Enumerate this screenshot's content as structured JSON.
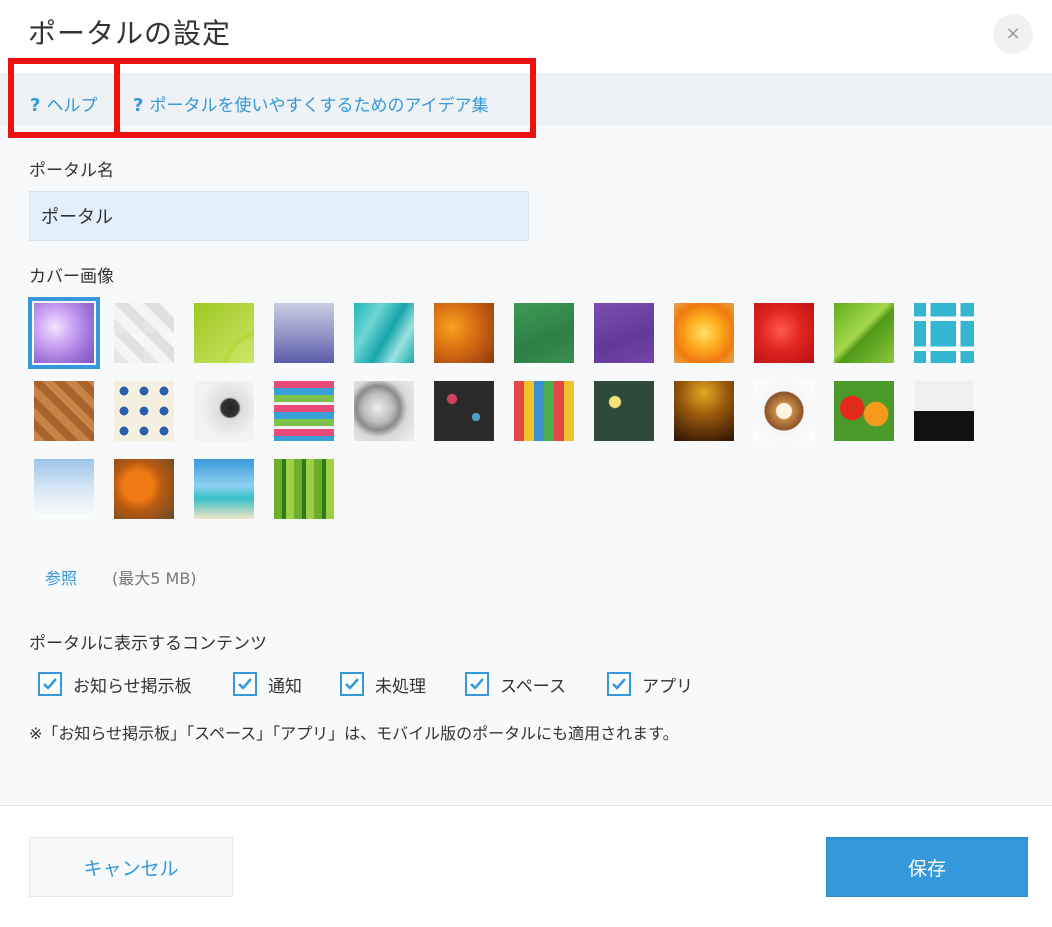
{
  "dialog": {
    "title": "ポータルの設定",
    "close_label": "×"
  },
  "help": {
    "help_label": "ヘルプ",
    "ideas_label": "ポータルを使いやすくするためのアイデア集",
    "question_mark": "?"
  },
  "portal_name": {
    "label": "ポータル名",
    "value": "ポータル"
  },
  "cover": {
    "label": "カバー画像",
    "images": [
      {
        "name": "lilac-flowers",
        "selected": true
      },
      {
        "name": "white-geometric"
      },
      {
        "name": "green-curves"
      },
      {
        "name": "purple-blue-gradient"
      },
      {
        "name": "turquoise-texture"
      },
      {
        "name": "orange-grunge"
      },
      {
        "name": "green-fabric"
      },
      {
        "name": "purple-paper"
      },
      {
        "name": "orange-lily"
      },
      {
        "name": "red-carnation"
      },
      {
        "name": "green-leaf-droplet"
      },
      {
        "name": "blue-blocks"
      },
      {
        "name": "wood-herringbone"
      },
      {
        "name": "mosaic-tiles"
      },
      {
        "name": "compass-on-map"
      },
      {
        "name": "stacked-books"
      },
      {
        "name": "gear-on-paper"
      },
      {
        "name": "chalk-question-marks"
      },
      {
        "name": "colored-pencils"
      },
      {
        "name": "chalk-light-bulbs"
      },
      {
        "name": "golden-bokeh"
      },
      {
        "name": "latte-art"
      },
      {
        "name": "vegetables"
      },
      {
        "name": "cat"
      },
      {
        "name": "snowy-trees"
      },
      {
        "name": "pumpkins"
      },
      {
        "name": "beach-palm"
      },
      {
        "name": "bamboo"
      }
    ],
    "browse_label": "参照",
    "max_size": "(最大5 MB)"
  },
  "contents": {
    "label": "ポータルに表示するコンテンツ",
    "items": [
      {
        "label": "お知らせ掲示板",
        "checked": true
      },
      {
        "label": "通知",
        "checked": true
      },
      {
        "label": "未処理",
        "checked": true
      },
      {
        "label": "スペース",
        "checked": true
      },
      {
        "label": "アプリ",
        "checked": true
      }
    ],
    "note": "※「お知らせ掲示板」「スペース」「アプリ」は、モバイル版のポータルにも適用されます。"
  },
  "footer": {
    "cancel_label": "キャンセル",
    "save_label": "保存"
  },
  "colors": {
    "accent": "#3498db",
    "highlight_box": "#ee1111"
  }
}
